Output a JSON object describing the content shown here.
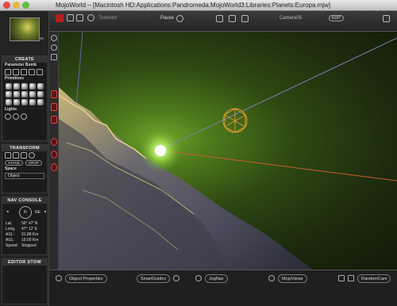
{
  "window": {
    "title": "MojoWorld – [Macintosh HD:Applications:Pandromeda:MojoWorld3:Libraries:Planets:Europa.mjw]"
  },
  "toolbar": {
    "render_mode": "Textured",
    "pause_label": "Pause",
    "camera_label": "Camera05",
    "edit_label": "EDIT"
  },
  "left_panel": {
    "create_title": "CREATE",
    "parameter_bomb": "Parameter Bomb",
    "primitives": "Primitives",
    "lights": "Lights",
    "transform_title": "TRANSFORM",
    "stand_label": "STAND",
    "drop_label": "DROP",
    "space_label": "Space",
    "space_value": "Object",
    "nav_console_title": "NAV CONSOLE",
    "compass_n": "N",
    "compass_ne": "NE",
    "nav_rows": [
      {
        "key": "Lat.",
        "value": "56° 47' N"
      },
      {
        "key": "Long.",
        "value": "47° 12' E"
      },
      {
        "key": "ASL:",
        "value": "91.88 Km"
      },
      {
        "key": "AGL:",
        "value": "10.00 Km"
      },
      {
        "key": "Speed:",
        "value": "Stopped"
      }
    ],
    "editor_stow_title": "EDITOR STOW"
  },
  "bottom_bar": {
    "object_properties": "Object Properties",
    "smart_guides": "SmartGuides",
    "jog_nav": "JogNav",
    "mojo_views": "MojoViews",
    "random_cam": "RandomCam"
  },
  "colors": {
    "accent_red": "#b02020",
    "sky_glow": "#6ea52a",
    "gizmo_orange": "#e09a30"
  }
}
